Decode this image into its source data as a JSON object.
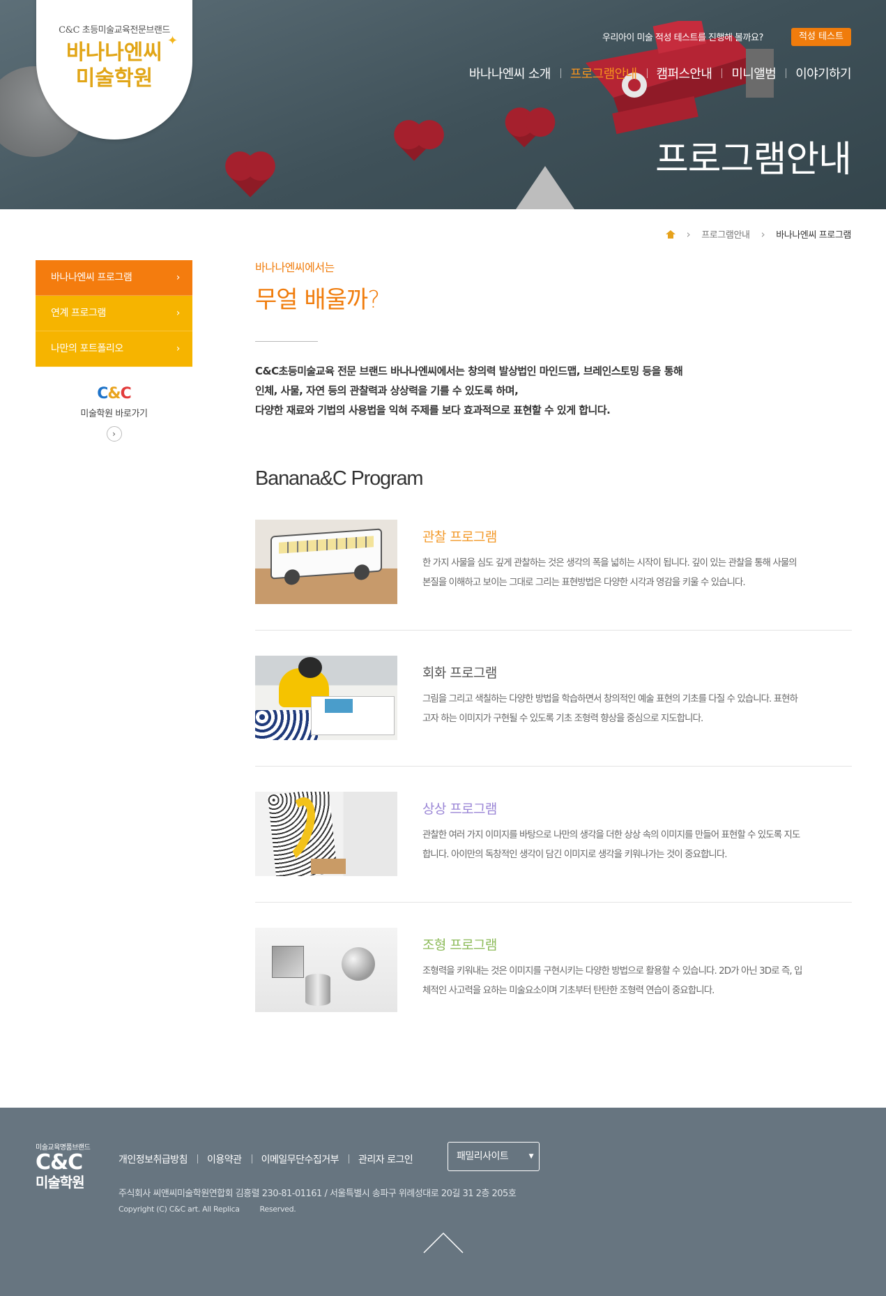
{
  "brand": {
    "sub": "C&C 초등미술교육전문브랜드",
    "main_line1": "바나나엔씨",
    "main_line2": "미술학원"
  },
  "header": {
    "prompt": "우리아이 미술 적성 테스트를 진행해 볼까요?",
    "aptitude_button": "적성 테스트",
    "nav": [
      {
        "label": "바나나엔씨 소개",
        "active": false
      },
      {
        "label": "프로그램안내",
        "active": true
      },
      {
        "label": "캠퍼스안내",
        "active": false
      },
      {
        "label": "미니앨범",
        "active": false
      },
      {
        "label": "이야기하기",
        "active": false
      }
    ],
    "hero_title": "프로그램안내"
  },
  "breadcrumb": {
    "level1": "프로그램안내",
    "current": "바나나엔씨 프로그램"
  },
  "sidebar": {
    "items": [
      {
        "label": "바나나엔씨 프로그램",
        "active": true
      },
      {
        "label": "연계 프로그램",
        "active": false
      },
      {
        "label": "나만의 포트폴리오",
        "active": false
      }
    ],
    "cc_logo": {
      "c1": "C",
      "amp": "&",
      "c2": "C"
    },
    "cc_label": "미술학원 바로가기"
  },
  "intro": {
    "kicker": "바나나엔씨에서는",
    "title": "무얼 배울까?",
    "body_lines": [
      "C&C초등미술교육 전문 브랜드 바나나엔씨에서는 창의력 발상법인 마인드맵, 브레인스토밍 등을 통해",
      "인체, 사물, 자연 등의 관찰력과 상상력을 기를 수 있도록 하며,",
      "다양한 재료와 기법의 사용법을 익혀 주제를 보다 효과적으로 표현할 수 있게 합니다."
    ]
  },
  "section_title": "Banana&C Program",
  "programs": [
    {
      "title": "관찰 프로그램",
      "color": "#f39a2b",
      "desc_lines": [
        "한 가지 사물을 심도 깊게 관찰하는 것은 생각의 폭을 넓히는 시작이 됩니다. 깊이 있는 관찰을 통해 사물의",
        "본질을 이해하고 보이는 그대로 그리는 표현방법은 다양한 시각과 영감을 키울 수 있습니다."
      ]
    },
    {
      "title": "회화 프로그램",
      "color": "#555555",
      "desc_lines": [
        "그림을 그리고 색칠하는 다양한 방법을 학습하면서 창의적인 예술 표현의 기초를 다질 수 있습니다. 표현하",
        "고자 하는 이미지가 구현될 수 있도록 기초 조형력 향상을 중심으로 지도합니다."
      ]
    },
    {
      "title": "상상 프로그램",
      "color": "#9b86d6",
      "desc_lines": [
        "관찰한 여러 가지 이미지를 바탕으로 나만의 생각을 더한 상상 속의 이미지를 만들어 표현할 수 있도록 지도",
        "합니다. 아이만의 독창적인 생각이 담긴 이미지로 생각을 키워나가는 것이 중요합니다."
      ]
    },
    {
      "title": "조형 프로그램",
      "color": "#8dbb5a",
      "desc_lines": [
        "조형력을 키워내는 것은 이미지를 구현시키는 다양한 방법으로 활용할 수 있습니다. 2D가 아닌 3D로 즉, 입",
        "체적인 사고력을 요하는 미술요소이며 기초부터 탄탄한 조형력 연습이 중요합니다."
      ]
    }
  ],
  "footer": {
    "logo_tag": "미술교육명품브랜드",
    "logo_cc": "C&C",
    "logo_name": "미술학원",
    "links": [
      "개인정보취급방침",
      "이용약관",
      "이메일무단수집거부",
      "관리자 로그인"
    ],
    "family_site": "패밀리사이트",
    "info": "주식회사 씨앤씨미술학원연합회 김흥렬 230-81-01161 / 서울특별시 송파구 위례성대로 20길 31 2층 205호",
    "copyright": "Copyright (C) C&C art. All Replica         Reserved."
  },
  "colors": {
    "accent": "#f07c0c",
    "sidebar_yellow": "#f6b400",
    "hero_bg": "#4a5c64",
    "footer_bg": "#677580"
  }
}
